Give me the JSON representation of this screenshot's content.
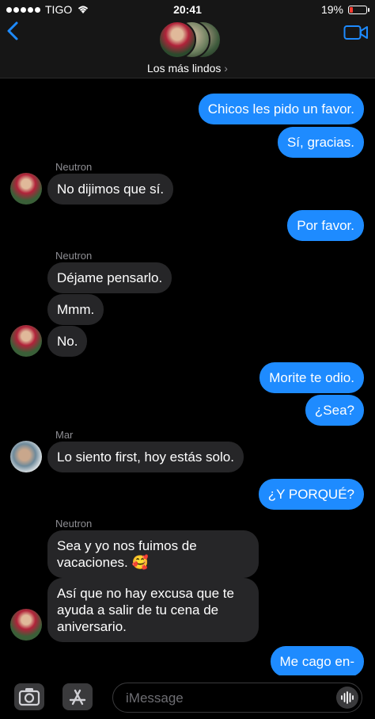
{
  "status_bar": {
    "carrier": "TIGO",
    "time": "20:41",
    "battery": "19%",
    "battery_level": 0.19
  },
  "header": {
    "group_name": "Los más lindos"
  },
  "messages": [
    {
      "dir": "out",
      "text": "Chicos les pido un favor."
    },
    {
      "dir": "out",
      "text": "Sí, gracias."
    },
    {
      "dir": "in",
      "sender": "Neutron",
      "text": "No dijimos que sí."
    },
    {
      "dir": "out",
      "text": "Por favor."
    },
    {
      "dir": "in",
      "sender": "Neutron",
      "text": "Déjame pensarlo."
    },
    {
      "dir": "in",
      "text": "Mmm."
    },
    {
      "dir": "in",
      "text": "No."
    },
    {
      "dir": "out",
      "text": "Morite te odio."
    },
    {
      "dir": "out",
      "text": "¿Sea?"
    },
    {
      "dir": "in",
      "sender": "Mar",
      "text": "Lo siento first, hoy estás solo."
    },
    {
      "dir": "out",
      "text": "¿Y PORQUÉ?"
    },
    {
      "dir": "in",
      "sender": "Neutron",
      "text": "Sea y yo nos fuimos de\nvacaciones. 🥰"
    },
    {
      "dir": "in",
      "text": "Así que no hay excusa que te\nayuda a salir de tu cena de\naniversario."
    },
    {
      "dir": "out",
      "text": "Me cago en-"
    }
  ],
  "input": {
    "placeholder": "iMessage"
  },
  "colors": {
    "outgoing": "#1e8bff",
    "incoming": "#262628",
    "accent": "#1e8bff"
  }
}
